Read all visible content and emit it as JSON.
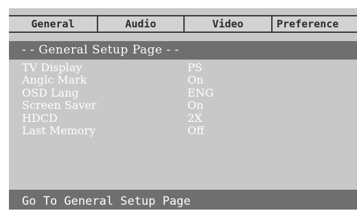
{
  "tabs": [
    {
      "label": "General"
    },
    {
      "label": "Audio"
    },
    {
      "label": "Video"
    },
    {
      "label": "Preference"
    }
  ],
  "page_title": "- - General Setup Page - -",
  "settings": [
    {
      "name": "TV Display",
      "value": "PS"
    },
    {
      "name": "Anglc Mark",
      "value": "On"
    },
    {
      "name": "OSD Lang",
      "value": "ENG"
    },
    {
      "name": "Screen Saver",
      "value": "On"
    },
    {
      "name": "HDCD",
      "value": "2X"
    },
    {
      "name": "Last Memory",
      "value": "Off"
    }
  ],
  "footer_text": "Go To General Setup Page",
  "colors": {
    "panel_bg": "#c8c8c8",
    "header_bg": "#6f6f6f",
    "text_light": "#ffffff",
    "tab_text": "#2a2a2a"
  }
}
